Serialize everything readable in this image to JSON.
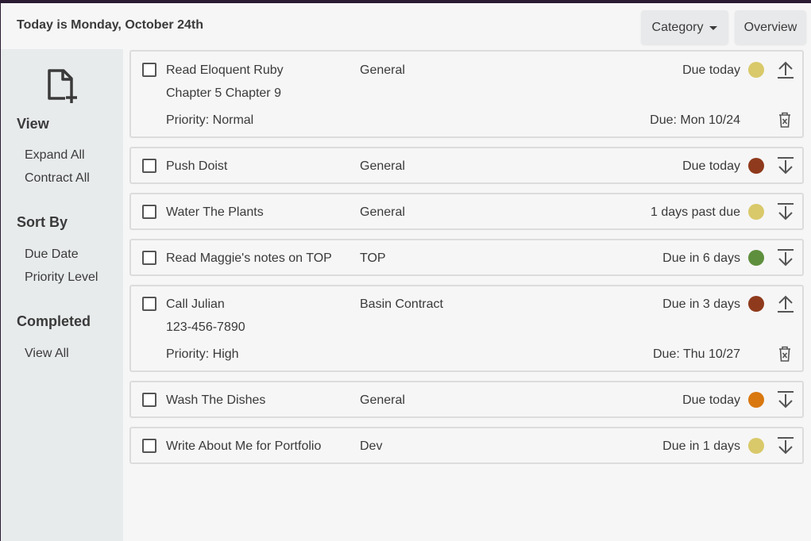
{
  "header": {
    "today": "Today is Monday, October 24th",
    "category_label": "Category",
    "overview_label": "Overview"
  },
  "sidebar": {
    "new_task_icon": "file-plus-icon",
    "view_heading": "View",
    "expand_all": "Expand All",
    "contract_all": "Contract All",
    "sort_heading": "Sort By",
    "sort_due_date": "Due Date",
    "sort_priority": "Priority Level",
    "completed_heading": "Completed",
    "view_all": "View All"
  },
  "colors": {
    "yellow": "#d9c96a",
    "red": "#8f3a1c",
    "green": "#5e8f3d",
    "orange": "#d9780f"
  },
  "tasks": [
    {
      "title": "Read Eloquent Ruby",
      "category": "General",
      "due": "Due today",
      "dot": "yellow",
      "expanded": true,
      "notes": "Chapter 5 Chapter 9",
      "priority": "Priority: Normal",
      "due_date": "Due: Mon 10/24"
    },
    {
      "title": "Push Doist",
      "category": "General",
      "due": "Due today",
      "dot": "red",
      "expanded": false
    },
    {
      "title": "Water The Plants",
      "category": "General",
      "due": "1 days past due",
      "dot": "yellow",
      "expanded": false
    },
    {
      "title": "Read Maggie's notes on TOP",
      "category": "TOP",
      "due": "Due in 6 days",
      "dot": "green",
      "expanded": false
    },
    {
      "title": "Call Julian",
      "category": "Basin Contract",
      "due": "Due in 3 days",
      "dot": "red",
      "expanded": true,
      "notes": "123-456-7890",
      "priority": "Priority: High",
      "due_date": "Due: Thu 10/27"
    },
    {
      "title": "Wash The Dishes",
      "category": "General",
      "due": "Due today",
      "dot": "orange",
      "expanded": false
    },
    {
      "title": "Write About Me for Portfolio",
      "category": "Dev",
      "due": "Due in 1 days",
      "dot": "yellow",
      "expanded": false
    }
  ]
}
